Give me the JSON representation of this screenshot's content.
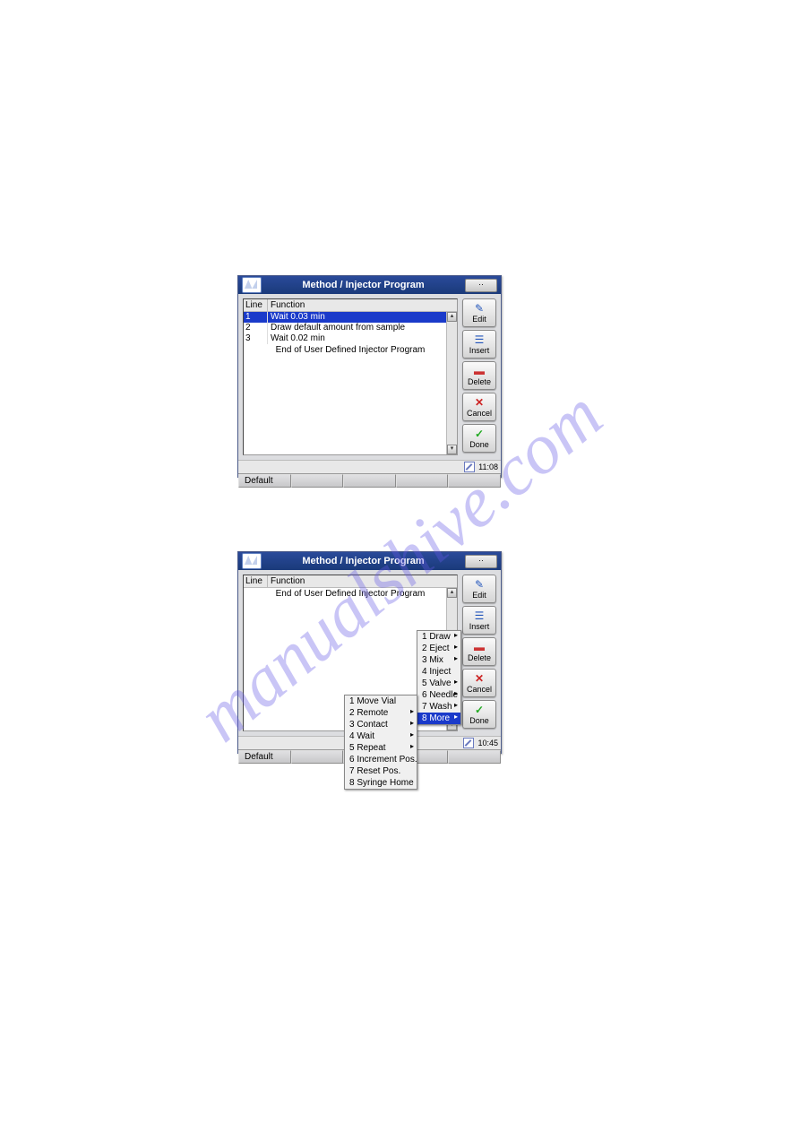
{
  "watermark": "manualshive.com",
  "panel1": {
    "title": "Method / Injector Program",
    "table": {
      "col_line": "Line",
      "col_function": "Function",
      "rows": [
        {
          "line": "1",
          "func": "Wait 0.03 min"
        },
        {
          "line": "2",
          "func": "Draw default amount from sample"
        },
        {
          "line": "3",
          "func": "Wait 0.02 min"
        }
      ],
      "end_row": "End of User Defined Injector Program"
    },
    "buttons": {
      "edit": "Edit",
      "insert": "Insert",
      "delete": "Delete",
      "cancel": "Cancel",
      "done": "Done"
    },
    "status_time": "11:08",
    "footer_default": "Default",
    "titlebar_btn": "··"
  },
  "panel2": {
    "title": "Method / Injector Program",
    "table": {
      "col_line": "Line",
      "col_function": "Function",
      "end_row": "End of User Defined Injector Program"
    },
    "buttons": {
      "edit": "Edit",
      "insert": "Insert",
      "delete": "Delete",
      "cancel": "Cancel",
      "done": "Done"
    },
    "popup1": [
      {
        "label": "1 Draw",
        "arrow": true
      },
      {
        "label": "2 Eject",
        "arrow": true
      },
      {
        "label": "3 Mix",
        "arrow": true
      },
      {
        "label": "4 Inject",
        "arrow": false
      },
      {
        "label": "5 Valve",
        "arrow": true
      },
      {
        "label": "6 Needle",
        "arrow": true
      },
      {
        "label": "7 Wash",
        "arrow": true
      },
      {
        "label": "8 More",
        "arrow": true,
        "selected": true
      }
    ],
    "popup2": [
      {
        "label": "1 Move Vial",
        "arrow": false
      },
      {
        "label": "2 Remote",
        "arrow": true
      },
      {
        "label": "3 Contact",
        "arrow": true
      },
      {
        "label": "4 Wait",
        "arrow": true
      },
      {
        "label": "5 Repeat",
        "arrow": true
      },
      {
        "label": "6 Increment Pos.",
        "arrow": false
      },
      {
        "label": "7 Reset Pos.",
        "arrow": false
      },
      {
        "label": "8 Syringe Home",
        "arrow": false
      }
    ],
    "status_time": "10:45",
    "footer_default": "Default",
    "titlebar_btn": "··"
  }
}
